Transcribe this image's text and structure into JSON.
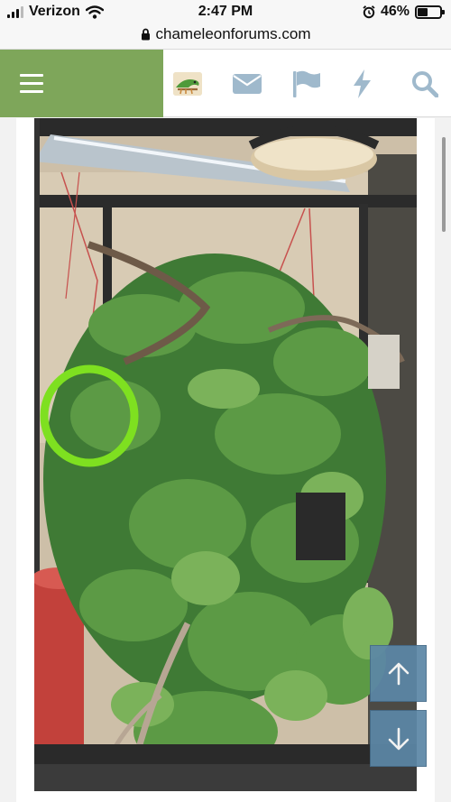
{
  "status_bar": {
    "carrier": "Verizon",
    "time": "2:47 PM",
    "battery_percent": "46%",
    "battery_level": 0.46
  },
  "browser": {
    "url": "chameleonforums.com"
  },
  "nav": {
    "menu_icon": "hamburger-menu-icon",
    "icons": [
      "site-logo",
      "envelope-icon",
      "flag-icon",
      "lightning-bolt-icon",
      "search-icon"
    ],
    "accent_color": "#7ea65a",
    "icon_color": "#9fb9cc"
  },
  "attachment": {
    "subject": "photo of a terrarium enclosure full of pothos plants, vines and branches, with a green circle drawn on the left side",
    "annotation_color": "#7ee020"
  },
  "jump_controls": {
    "up_icon": "arrow-up-icon",
    "down_icon": "arrow-down-icon",
    "color": "#5c87a6"
  }
}
